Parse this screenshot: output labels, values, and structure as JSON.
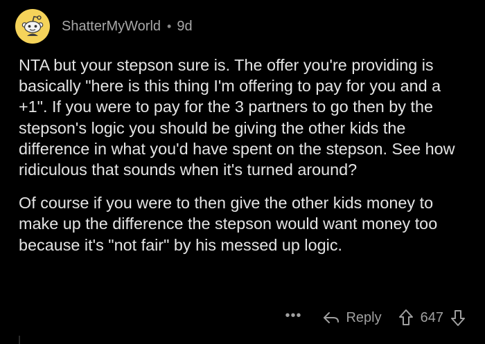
{
  "comment": {
    "author": "ShatterMyWorld",
    "separator": "•",
    "age": "9d",
    "paragraphs": [
      "NTA but your stepson sure is. The offer you're providing is basically \"here is this thing I'm offering to pay for you and a +1\". If you were to pay for the 3 partners to go then by the stepson's logic you should be giving the other kids the difference in what you'd have spent on the stepson. See how ridiculous that sounds when it's turned around?",
      "Of course if you were to then give the other kids money to make up the difference the stepson would want money too because it's \"not fair\" by his messed up logic."
    ]
  },
  "actions": {
    "more_label": "•••",
    "reply_label": "Reply",
    "vote_count": "647"
  },
  "icons": {
    "avatar": "snoo-avatar-icon",
    "reply": "reply-arrow-icon",
    "upvote": "upvote-arrow-icon",
    "downvote": "downvote-arrow-icon"
  },
  "colors": {
    "background": "#000000",
    "avatar_bg": "#f5d35a",
    "text": "#e4e4e4",
    "muted": "#a0a0a0"
  }
}
